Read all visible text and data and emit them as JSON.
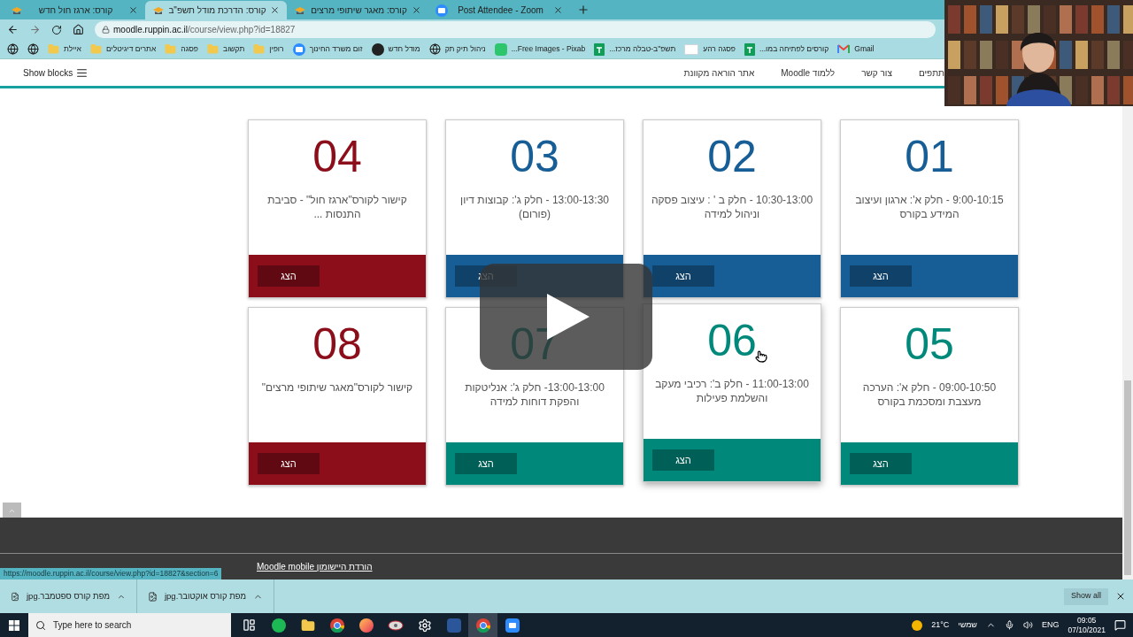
{
  "tabs": [
    {
      "label": "Post Attendee - Zoom",
      "kind": "zoom",
      "selected": false
    },
    {
      "label": "קורס: מאגר שיתופי מרצים",
      "kind": "moodle",
      "selected": false
    },
    {
      "label": "קורס: הדרכת מודל תשפ\"ב",
      "kind": "moodle",
      "selected": true
    },
    {
      "label": "קורס: ארגז חול חדש",
      "kind": "moodle",
      "selected": false
    }
  ],
  "address": {
    "host": "moodle.ruppin.ac.il",
    "path": "/course/view.php?id=18827"
  },
  "bookmarks": [
    {
      "kind": "gmail",
      "label": "Gmail"
    },
    {
      "kind": "sheets",
      "label": "קורסים לפתיחה במו..."
    },
    {
      "kind": "wix",
      "label": "פסגה רהע"
    },
    {
      "kind": "sheets",
      "label": "תשפ\"ב-טבלה מרכז..."
    },
    {
      "kind": "pixabay",
      "label": "Free Images - Pixab..."
    },
    {
      "kind": "globe",
      "label": "ניהול תיק תק"
    },
    {
      "kind": "moodle",
      "label": "מודל חדש"
    },
    {
      "kind": "zoom",
      "label": "זום משרד החינוך"
    },
    {
      "kind": "folder",
      "label": "רופין"
    },
    {
      "kind": "folder",
      "label": "תקשוב"
    },
    {
      "kind": "folder",
      "label": "פסגה"
    },
    {
      "kind": "folder",
      "label": "אתרים דיגיטלים"
    },
    {
      "kind": "folder",
      "label": "איילת"
    },
    {
      "kind": "globe"
    },
    {
      "kind": "globe"
    }
  ],
  "show_blocks": "Show blocks",
  "nav": [
    "תתפים",
    "צור קשר",
    "ללמוד Moodle",
    "אתר הוראה מקוונת"
  ],
  "cards": [
    {
      "number": "01",
      "text": "9:00-10:15 - חלק א': ארגון ועיצוב המידע בקורס",
      "button": "הצג",
      "color": "#175e96",
      "hovered": false
    },
    {
      "number": "02",
      "text": "10:30-13:00 - חלק ב ' : עיצוב פסקה וניהול למידה",
      "button": "הצג",
      "color": "#175e96",
      "hovered": false
    },
    {
      "number": "03",
      "text": "13:00-13:30 - חלק ג': קבוצות דיון (פורום)",
      "button": "הצג",
      "color": "#175e96",
      "hovered": false
    },
    {
      "number": "04",
      "text": "קישור לקורס\"ארגז חול\" - סביבת התנסות ...",
      "button": "הצג",
      "color": "#8b0e1a",
      "hovered": false
    },
    {
      "number": "05",
      "text": "09:00-10:50 - חלק א': הערכה מעצבת ומסכמת בקורס",
      "button": "הצג",
      "color": "#00897b",
      "hovered": false
    },
    {
      "number": "06",
      "text": "11:00-13:00 - חלק ב': רכיבי מעקב והשלמת פעילות",
      "button": "הצג",
      "color": "#00897b",
      "hovered": true
    },
    {
      "number": "07",
      "text": "13:00-13:00- חלק ג': אנליטקות והפקת דוחות למידה",
      "button": "הצג",
      "color": "#00897b",
      "hovered": false
    },
    {
      "number": "08",
      "text": "קישור לקורס\"מאגר שיתופי מרצים\"",
      "button": "הצג",
      "color": "#8b0e1a",
      "hovered": false
    }
  ],
  "footer_link": "הורדת היישומון Moodle mobile",
  "status_url": "https://moodle.ruppin.ac.il/course/view.php?id=18827&section=6",
  "downloads": [
    "מפת קורס אוקטובר.jpg",
    "מפת קורס ספטמבר.jpg"
  ],
  "show_all": "Show all",
  "taskbar": {
    "search_placeholder": "Type here to search",
    "apps": [
      {
        "kind": "taskview",
        "active": false
      },
      {
        "kind": "spotify",
        "active": false
      },
      {
        "kind": "explorer",
        "active": false
      },
      {
        "kind": "chrome",
        "active": false
      },
      {
        "kind": "firefox",
        "active": false
      },
      {
        "kind": "app",
        "active": false
      },
      {
        "kind": "settings",
        "active": false
      },
      {
        "kind": "word",
        "active": false
      },
      {
        "kind": "chrome",
        "active": true
      },
      {
        "kind": "zoom",
        "active": false
      }
    ],
    "temperature": "21°C",
    "weather": "שמשי",
    "language": "ENG",
    "time": "09:05",
    "date": "07/10/2021"
  }
}
